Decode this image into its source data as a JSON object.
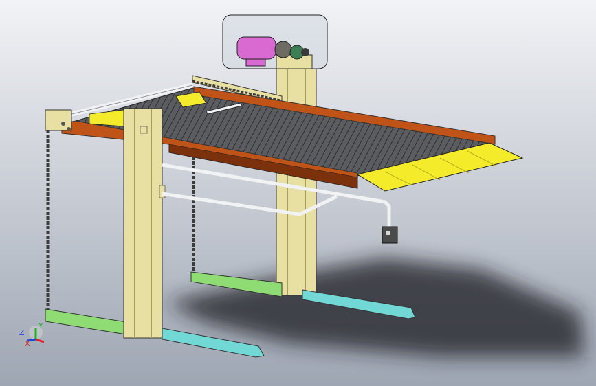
{
  "viewport": {
    "background_top": "#f2f3f6",
    "background_bottom": "#9ea6b3"
  },
  "model": {
    "colors": {
      "frame_post": "#e8e0a2",
      "frame_post_dark": "#a69f5c",
      "platform_rail": "#c05418",
      "platform_rail_dark": "#7a310c",
      "deck": "#5a5c60",
      "deck_line": "#2d2e31",
      "ramp": "#f4ec2a",
      "ramp_dark": "#b8b020",
      "base_left": "#8fdc74",
      "base_right": "#72d8d6",
      "motor": "#d86ad2",
      "motor_housing": "#c9d3dc",
      "pipe": "#f1f2f4",
      "chain": "#3c3c3c",
      "control_box": "#4a4a4a",
      "shadow": "#1c1d20"
    }
  },
  "triad": {
    "x_label": "X",
    "y_label": "Y",
    "z_label": "Z",
    "x_color": "#e52121",
    "y_color": "#21b121",
    "z_color": "#2342d9"
  }
}
